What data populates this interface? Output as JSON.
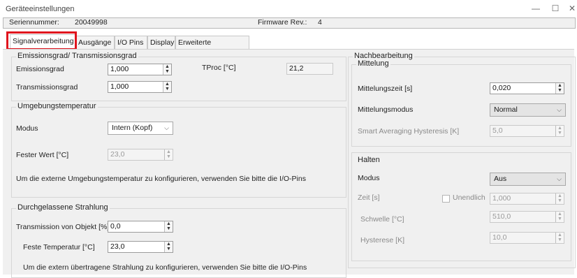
{
  "window": {
    "title": "Geräteeinstellungen",
    "controls": {
      "minimize": "—",
      "maximize": "☐",
      "close": "✕"
    }
  },
  "info": {
    "serial_label": "Seriennummer:",
    "serial_value": "20049998",
    "firmware_label": "Firmware Rev.:",
    "firmware_value": "4"
  },
  "tabs": [
    "Signalverarbeitung",
    "Ausgänge",
    "I/O Pins",
    "Display",
    "Erweiterte Einstellungen"
  ],
  "active_tab": "Signalverarbeitung",
  "highlight_color": "#e0141e",
  "emission": {
    "title": "Emissionsgrad/ Transmissionsgrad",
    "emissionsgrad_label": "Emissionsgrad",
    "emissionsgrad_value": "1,000",
    "tproc_label": "TProc [°C]",
    "tproc_value": "21,2",
    "transmissionsgrad_label": "Transmissionsgrad",
    "transmissionsgrad_value": "1,000"
  },
  "ambient": {
    "title": "Umgebungstemperatur",
    "modus_label": "Modus",
    "modus_value": "Intern (Kopf)",
    "fester_wert_label": "Fester Wert [°C]",
    "fester_wert_value": "23,0",
    "note": "Um die externe Umgebungstemperatur zu konfigurieren, verwenden Sie bitte die I/O-Pins"
  },
  "transmitted": {
    "title": "Durchgelassene Strahlung",
    "transmission_label": "Transmission von Objekt [%]",
    "transmission_value": "0,0",
    "feste_temp_label": "Feste Temperatur [°C]",
    "feste_temp_value": "23,0",
    "note": "Um die extern übertragene Strahlung zu konfigurieren, verwenden Sie bitte die I/O-Pins"
  },
  "postprocessing": {
    "title": "Nachbearbeitung",
    "averaging": {
      "title": "Mittelung",
      "zeit_label": "Mittelungszeit [s]",
      "zeit_value": "0,020",
      "modus_label": "Mittelungsmodus",
      "modus_value": "Normal",
      "hysteresis_label": "Smart Averaging Hysteresis [K]",
      "hysteresis_value": "5,0"
    },
    "hold": {
      "title": "Halten",
      "modus_label": "Modus",
      "modus_value": "Aus",
      "zeit_label": "Zeit [s]",
      "unendlich_label": "Unendlich",
      "zeit_value": "1,000",
      "schwelle_label": "Schwelle [°C]",
      "schwelle_value": "510,0",
      "hysterese_label": "Hysterese [K]",
      "hysterese_value": "10,0"
    }
  }
}
